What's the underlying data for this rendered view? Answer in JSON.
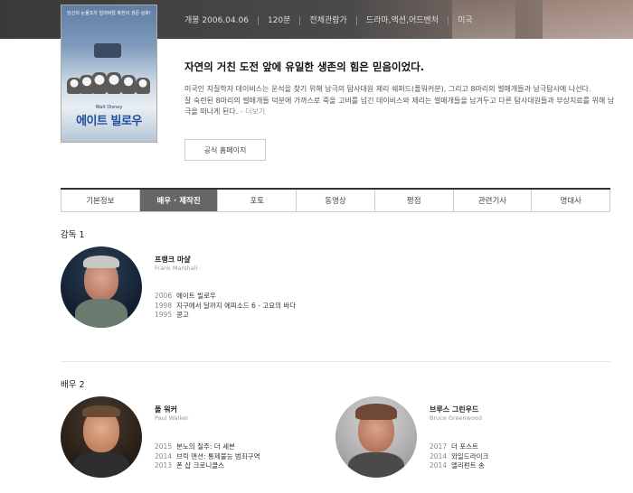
{
  "header": {
    "release": "개봉 2006.04.06",
    "runtime": "120분",
    "rating": "전체관람가",
    "genre": "드라마,액션,어드벤처",
    "country": "미국"
  },
  "poster": {
    "tagline": "당신의 눈물조차 얼려버릴 혹한의 생존 실화!",
    "studio": "Walt Disney",
    "title": "에이트 빌로우"
  },
  "synopsis": {
    "headline": "자연의 거친 도전 앞에 유일한 생존의 힘은 믿음이었다.",
    "line1": "미국인 지질학자 데이비스는 운석을 찾기 위해 남극의 탐사대원 제리 쉐퍼드(폴워커분), 그리고 8마리의 썰매개들과 남극탐사에 나선다.",
    "line2": "잘 숙련된 8마리의 썰매개들 덕분에 가까스로 죽을 고비를 넘긴 데이비스와 제리는 썰매개들을 남겨두고 다른 탐사대원들과 부상치료를 위해 남",
    "line3": "극을 떠나게 된다.",
    "more": "- 더보기"
  },
  "homepage_button": "공식 홈페이지",
  "tabs": [
    "기본정보",
    "배우 · 제작진",
    "포토",
    "동영상",
    "평점",
    "관련기사",
    "명대사"
  ],
  "director_section": {
    "title": "감독 1",
    "people": [
      {
        "name_ko": "프랭크 마샬",
        "name_en": "Frank Marshall",
        "films": [
          {
            "year": "2006",
            "title": "에이트 빌로우"
          },
          {
            "year": "1998",
            "title": "지구에서 달까지 에피소드 6 - 고요의 바다"
          },
          {
            "year": "1995",
            "title": "콩고"
          }
        ]
      }
    ]
  },
  "actor_section": {
    "title": "배우 2",
    "people": [
      {
        "name_ko": "폴 워커",
        "name_en": "Paul Walker",
        "films": [
          {
            "year": "2015",
            "title": "분노의 질주: 더 세븐"
          },
          {
            "year": "2014",
            "title": "브릭 맨션: 통제불능 범죄구역"
          },
          {
            "year": "2013",
            "title": "폰 샵 크로니클스"
          }
        ]
      },
      {
        "name_ko": "브루스 그린우드",
        "name_en": "Bruce Greenwood",
        "films": [
          {
            "year": "2017",
            "title": "더 포스트"
          },
          {
            "year": "2014",
            "title": "와일드라이크"
          },
          {
            "year": "2014",
            "title": "엘리펀트 송"
          }
        ]
      }
    ]
  }
}
